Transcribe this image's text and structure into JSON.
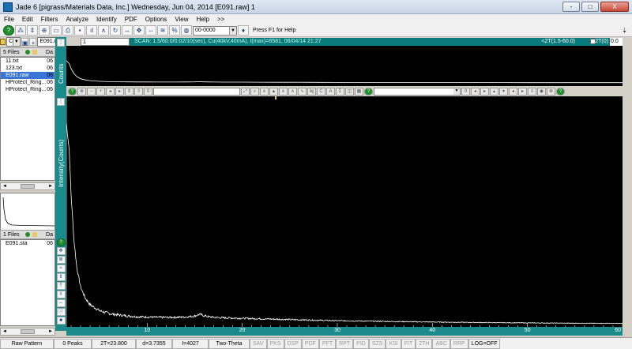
{
  "window": {
    "title": "Jade 6 [pigrass/Materials Data, Inc.] Wednesday, Jun 04, 2014 [E091.raw] 1",
    "controls": [
      "-",
      "□",
      "X"
    ]
  },
  "menu": [
    "File",
    "Edit",
    "Filters",
    "Analyze",
    "Identify",
    "PDF",
    "Options",
    "View",
    "Help",
    ">>"
  ],
  "toolbar": {
    "pdf_number": "00-0000",
    "help_hint": "Press F1 for Help"
  },
  "filebar": {
    "target": "Cu",
    "file": "E091.raw",
    "field": "1"
  },
  "left_panel": {
    "files_header": "5 Files",
    "files_col2": "Da",
    "files": [
      {
        "name": "11.txt",
        "tail": "06"
      },
      {
        "name": "123.txt",
        "tail": "06"
      },
      {
        "name": "E091.raw",
        "tail": "06"
      },
      {
        "name": "HProtect_Ring...",
        "tail": "06"
      },
      {
        "name": "HProtect_Ring...",
        "tail": "06"
      }
    ],
    "sta_header": "1 Files",
    "sta_col2": "Da",
    "sta_files": [
      {
        "name": "E091.sta",
        "tail": "06"
      }
    ]
  },
  "scan_info": {
    "text": "SCAN: 1.5/60.0/0.02/10(sec), Cu(40kV,40mA), I(max)=6581, 06/04/14 21:27",
    "range": "<2T(1.5-60.0)",
    "twotheta_label": "2T(0)",
    "twotheta_value": "0.0"
  },
  "overview": {
    "ylabel": "Counts"
  },
  "chart_data": {
    "type": "line",
    "title": "",
    "xlabel": "Two-Theta",
    "ylabel": "Intensity(Counts)",
    "xlim": [
      1.5,
      60
    ],
    "ylim": [
      0,
      4500
    ],
    "x_ticks": [
      10,
      20,
      30,
      40,
      50,
      60
    ],
    "grid": false,
    "series": [
      {
        "color": "#ffffff",
        "x": [
          1.5,
          1.8,
          2.0,
          2.3,
          2.6,
          3.0,
          3.5,
          4.0,
          5.0,
          6.0,
          7.0,
          8.0,
          9.0,
          10.0,
          11.0,
          12.0,
          13.0,
          14.0,
          15.0,
          15.5,
          16.0,
          16.5,
          17.0,
          18.0,
          20.0,
          22.0,
          24.0,
          26.0,
          28.0,
          30.0,
          35.0,
          40.0,
          45.0,
          50.0,
          55.0,
          60.0
        ],
        "y": [
          4027,
          3500,
          2600,
          1700,
          1150,
          760,
          540,
          410,
          290,
          235,
          205,
          185,
          170,
          165,
          160,
          158,
          160,
          165,
          185,
          220,
          190,
          170,
          160,
          150,
          140,
          130,
          120,
          110,
          100,
          92,
          78,
          66,
          56,
          48,
          42,
          38
        ]
      }
    ]
  },
  "status": {
    "pattern": "Raw Pattern",
    "peaks": "0 Peaks",
    "twotheta": "2T=23.800",
    "d": "d=3.7355",
    "intensity": "I=4027",
    "axis": "Two-Theta",
    "flags": [
      "SAV",
      "PKS",
      "DSP",
      "PDF",
      "PFT",
      "RPT",
      "PID",
      "SZS",
      "KSI",
      "FIT",
      "2TH",
      "ABC",
      "RRP"
    ],
    "log": "LOG=OFF"
  },
  "colors": {
    "plot_bg": "#000000",
    "trace": "#ffffff",
    "teal": "#1a8a8a"
  }
}
